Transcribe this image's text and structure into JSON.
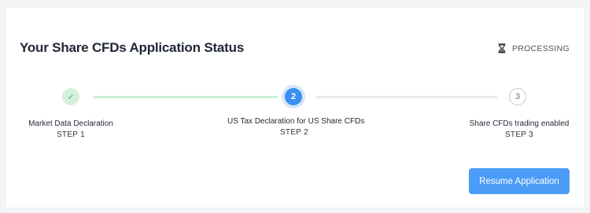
{
  "header": {
    "title": "Your Share CFDs Application Status",
    "status_icon": "hourglass-icon",
    "status_text": "PROCESSING"
  },
  "steps": [
    {
      "label": "Market Data Declaration",
      "step": "STEP 1",
      "marker": "✓",
      "state": "completed"
    },
    {
      "label": "US Tax Declaration for US Share CFDs",
      "step": "STEP 2",
      "marker": "2",
      "state": "current"
    },
    {
      "label": "Share CFDs trading enabled",
      "step": "STEP 3",
      "marker": "3",
      "state": "upcoming"
    }
  ],
  "actions": {
    "resume_label": "Resume Application"
  },
  "colors": {
    "accent": "#3b8ff0",
    "button": "#4a9cf6",
    "completed": "#49b36a",
    "completed_bg": "#d5f0dc",
    "pending_line": "#e6e9ee"
  }
}
